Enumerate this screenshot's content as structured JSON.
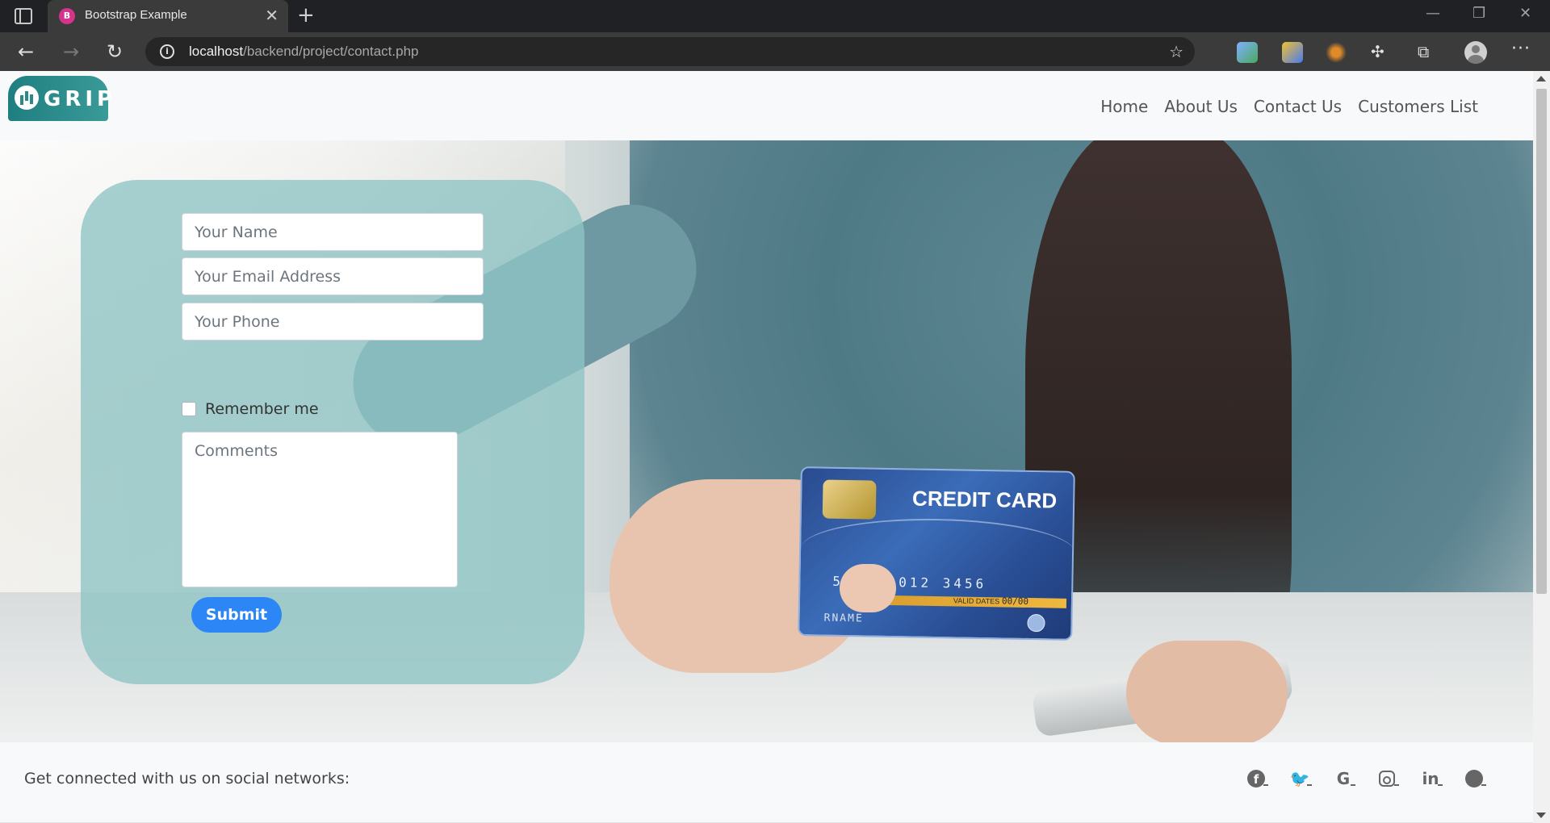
{
  "browser": {
    "tab_title": "Bootstrap Example",
    "tab_close": "✕",
    "new_tab": "+",
    "url_host": "localhost",
    "url_path": "/backend/project/contact.php"
  },
  "navbar": {
    "logo_text": "GRIP",
    "links": [
      "Home",
      "About Us",
      "Contact Us",
      "Customers List"
    ]
  },
  "hero": {
    "card": {
      "title": "CREDIT CARD",
      "number": "5678  9012  3456",
      "valid_label": "VALID DATES",
      "valid_value": "00/00",
      "name": "RNAME"
    }
  },
  "form": {
    "name_placeholder": "Your Name",
    "email_placeholder": "Your Email Address",
    "phone_placeholder": "Your Phone",
    "remember_label": "Remember me",
    "remember_checked": false,
    "comments_placeholder": "Comments",
    "submit_label": "Submit",
    "submit_color": "#2d86f5",
    "panel_color": "#8ec4c4"
  },
  "footer": {
    "social_text": "Get connected with us on social networks:",
    "social_icons": [
      "facebook-icon",
      "twitter-icon",
      "google-icon",
      "instagram-icon",
      "linkedin-icon",
      "github-icon"
    ]
  }
}
